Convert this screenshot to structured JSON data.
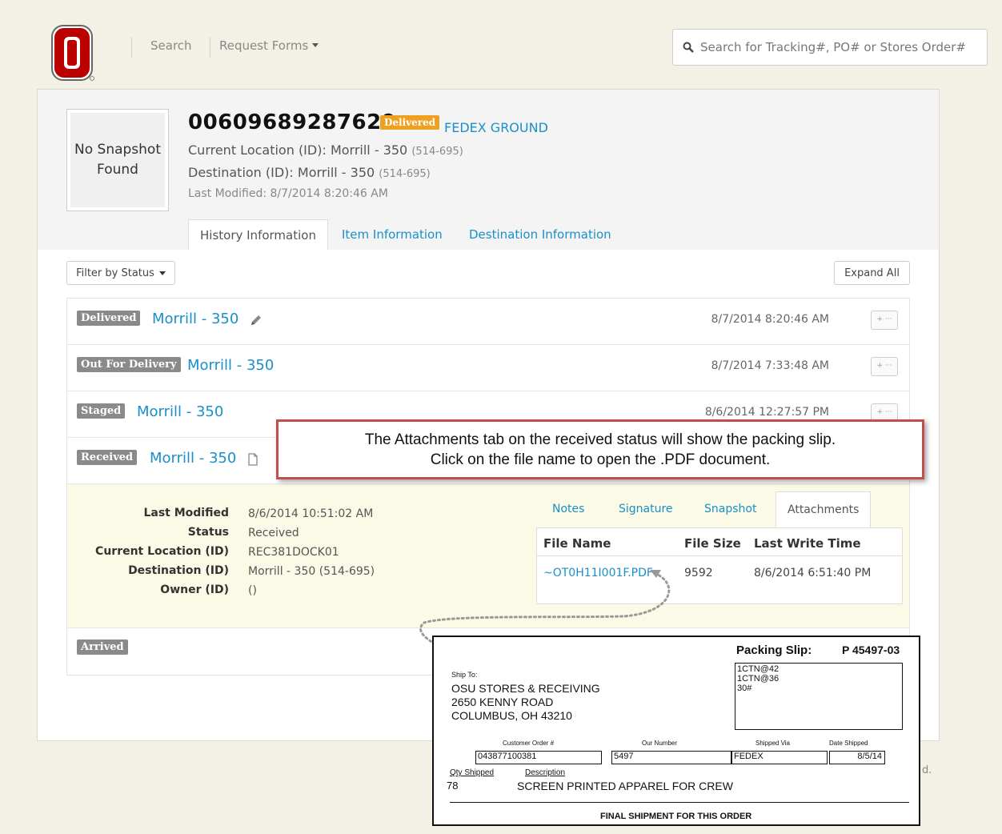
{
  "nav": {
    "search_link": "Search",
    "request_forms": "Request Forms",
    "search_placeholder": "Search for Tracking#, PO# or Stores Order#"
  },
  "colors": {
    "accent": "#1a8fc9",
    "delivered": "#f0a020",
    "status_gray": "#8a8a8a",
    "callout_border": "#c0504d"
  },
  "package": {
    "snapshot_text": "No Snapshot Found",
    "tracking": "00609689287629",
    "status": "Delivered",
    "carrier": "FEDEX GROUND",
    "current_location_label": "Current Location (ID): Morrill - 350",
    "current_location_code": "(514-695)",
    "destination_label": "Destination (ID): Morrill - 350",
    "destination_code": "(514-695)",
    "last_modified": "Last Modified: 8/7/2014 8:20:46 AM"
  },
  "tabs": [
    "History Information",
    "Item Information",
    "Destination Information"
  ],
  "filter_label": "Filter by Status",
  "expand_all": "Expand All",
  "history": [
    {
      "status": "Delivered",
      "location": "Morrill - 350",
      "time": "8/7/2014 8:20:46 AM"
    },
    {
      "status": "Out For Delivery",
      "location": "Morrill - 350",
      "time": "8/7/2014 7:33:48 AM"
    },
    {
      "status": "Staged",
      "location": "Morrill - 350",
      "time": "8/6/2014 12:27:57 PM"
    },
    {
      "status": "Received",
      "location": "Morrill - 350",
      "time": ""
    },
    {
      "status": "Arrived",
      "location": "",
      "time": ""
    }
  ],
  "mini_button": "+ ···",
  "detail": {
    "labels": [
      "Last Modified",
      "Status",
      "Current Location (ID)",
      "Destination (ID)",
      "Owner (ID)"
    ],
    "values": [
      "8/6/2014 10:51:02 AM",
      "Received",
      "REC381DOCK01",
      "Morrill - 350 (514-695)",
      "()"
    ]
  },
  "sub_tabs": [
    "Notes",
    "Signature",
    "Snapshot",
    "Attachments"
  ],
  "attachments": {
    "headers": [
      "File Name",
      "File Size",
      "Last Write Time"
    ],
    "file_name": "~OT0H11I001F.PDF",
    "file_size": "9592",
    "write_time": "8/6/2014 6:51:40 PM"
  },
  "callout": {
    "line1": "The Attachments tab on the received status will show the packing slip.",
    "line2": "Click on the file name to open the .PDF document."
  },
  "slip": {
    "title": "Packing Slip:",
    "number": "P 45497-03",
    "ship_to": "Ship To:",
    "addr1": "OSU STORES & RECEIVING",
    "addr2": "2650 KENNY ROAD",
    "addr3": "COLUMBUS, OH  43210",
    "box1": "1CTN@42",
    "box2": "1CTN@36",
    "box3": "30#",
    "col_customer_order": "Customer Order #",
    "col_our_number": "Our Number",
    "col_shipped_via": "Shipped Via",
    "col_date_shipped": "Date Shipped",
    "customer_order": "043877100381",
    "our_number": "5497",
    "shipped_via": "FEDEX",
    "date_shipped": "8/5/14",
    "qty_label": "Qty Shipped",
    "desc_label": "Description",
    "qty": "78",
    "description": "SCREEN PRINTED APPAREL FOR CREW",
    "footer": "FINAL SHIPMENT FOR THIS ORDER"
  },
  "footer_fragment": "d."
}
